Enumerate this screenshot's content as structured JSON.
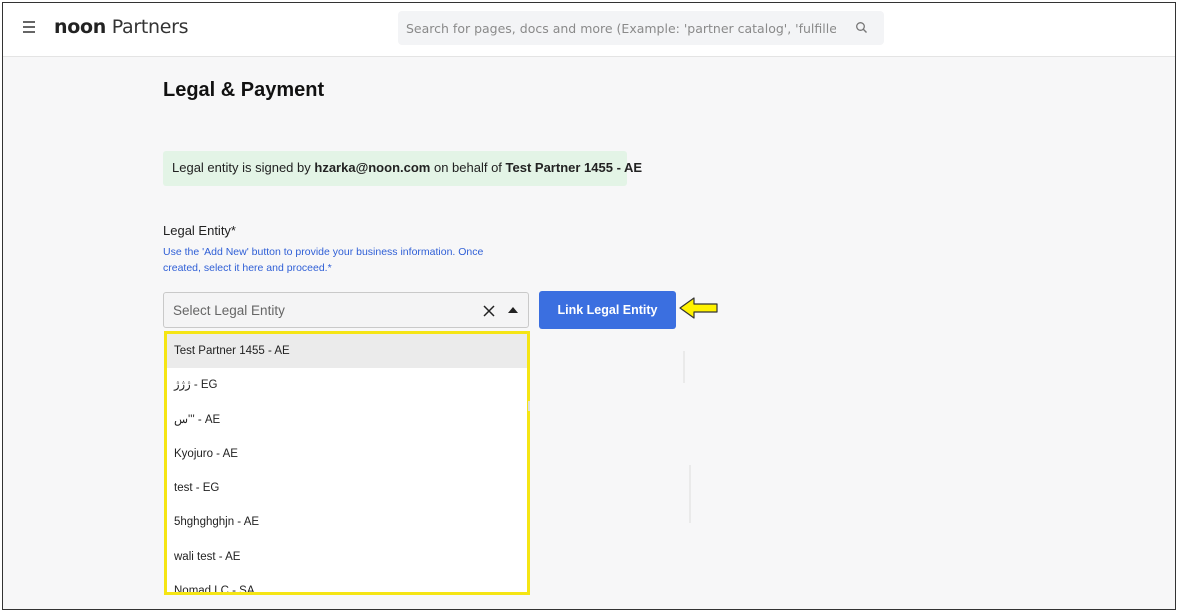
{
  "header": {
    "brand_bold": "noon",
    "brand_light": " Partners",
    "search_placeholder": "Search for pages, docs and more (Example: 'partner catalog', 'fulfilled by p"
  },
  "page": {
    "title": "Legal & Payment"
  },
  "notice": {
    "prefix": "Legal entity is signed by ",
    "email": "hzarka@noon.com",
    "middle": " on behalf of ",
    "partner": "Test Partner 1455 - AE"
  },
  "legal_entity": {
    "label": "Legal Entity*",
    "help": "Use the 'Add New' button to provide your business information. Once created, select it here and proceed.*",
    "select_placeholder": "Select Legal Entity",
    "link_button": "Link Legal Entity",
    "options": [
      "Test Partner 1455 - AE",
      "ژژژ - EG",
      "س''' - AE",
      "Kyojuro - AE",
      "test - EG",
      "5hghghghjn - AE",
      "wali test - AE",
      "Nomad LC - SA"
    ]
  },
  "colors": {
    "accent": "#3b6fe0",
    "notice_bg": "#e3f4e6",
    "highlight": "#f5e514",
    "help_text": "#2f5fd6"
  }
}
